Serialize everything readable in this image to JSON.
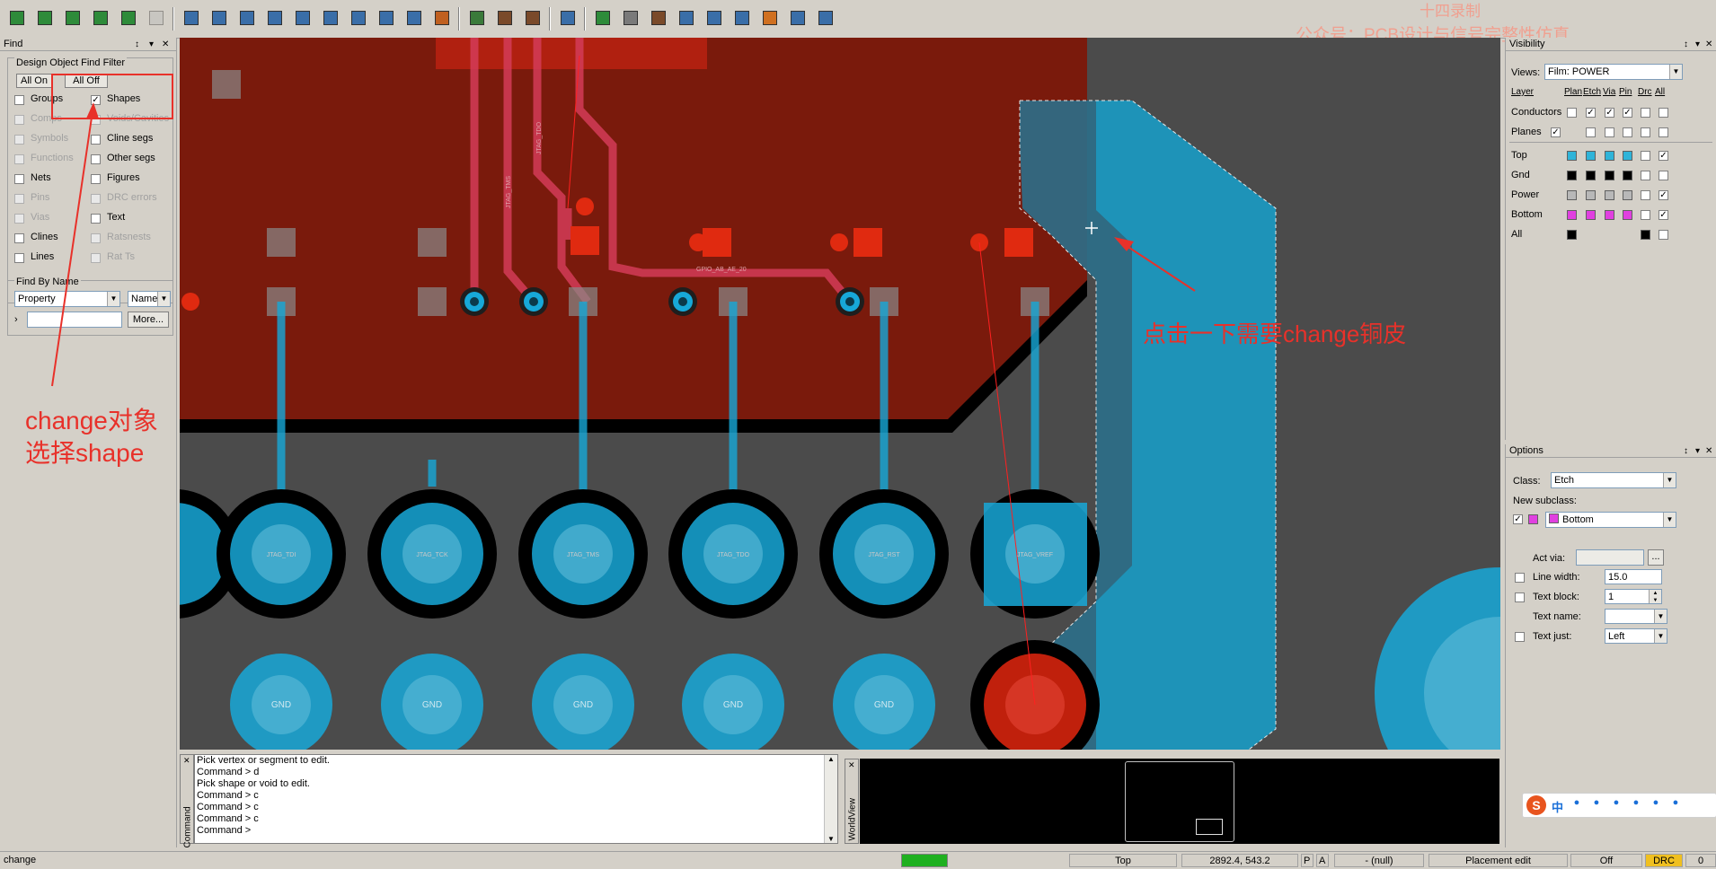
{
  "toolbar": {
    "icons": [
      "new-design-icon",
      "open-design-icon",
      "save-design-icon",
      "refresh-icon",
      "export-icon",
      "disabled-icon",
      "add-line-icon",
      "add-rect-icon",
      "add-circle-icon",
      "select-icon",
      "copy-icon",
      "rotate-icon",
      "shape-rect-icon",
      "shape-circle-icon",
      "void-icon",
      "merge-icon",
      "place-icon",
      "dimension-icon",
      "measure-icon",
      "route-icon",
      "via-icon",
      "fanout-icon",
      "slide-icon",
      "glossing-icon",
      "tuning-icon",
      "add-connect-icon",
      "spread-icon",
      "grid-icon",
      "colors-icon"
    ]
  },
  "watermark": {
    "line1": "十四录制",
    "line2": "公众号：PCB设计与信号完整性仿真"
  },
  "find_panel": {
    "title": "Find",
    "filter_title": "Design Object Find Filter",
    "all_on": "All On",
    "all_off": "All Off",
    "left_items": [
      {
        "label": "Groups",
        "enabled": true,
        "checked": false
      },
      {
        "label": "Comps",
        "enabled": false,
        "checked": false
      },
      {
        "label": "Symbols",
        "enabled": false,
        "checked": false
      },
      {
        "label": "Functions",
        "enabled": false,
        "checked": false
      },
      {
        "label": "Nets",
        "enabled": true,
        "checked": false
      },
      {
        "label": "Pins",
        "enabled": false,
        "checked": false
      },
      {
        "label": "Vias",
        "enabled": false,
        "checked": false
      },
      {
        "label": "Clines",
        "enabled": true,
        "checked": false
      },
      {
        "label": "Lines",
        "enabled": true,
        "checked": false
      }
    ],
    "right_items": [
      {
        "label": "Shapes",
        "enabled": true,
        "checked": true
      },
      {
        "label": "Voids/Cavities",
        "enabled": false,
        "checked": false
      },
      {
        "label": "Cline segs",
        "enabled": true,
        "checked": false
      },
      {
        "label": "Other segs",
        "enabled": true,
        "checked": false
      },
      {
        "label": "Figures",
        "enabled": true,
        "checked": false
      },
      {
        "label": "DRC errors",
        "enabled": false,
        "checked": false
      },
      {
        "label": "Text",
        "enabled": true,
        "checked": false
      },
      {
        "label": "Ratsnests",
        "enabled": false,
        "checked": false
      },
      {
        "label": "Rat Ts",
        "enabled": false,
        "checked": false
      }
    ],
    "find_by_name_title": "Find By Name",
    "property_select": "Property",
    "name_select": "Name",
    "name_input": "",
    "more_button": "More..."
  },
  "visibility_panel": {
    "title": "Visibility",
    "views_label": "Views:",
    "views_value": "Film: POWER",
    "headers": [
      "Layer",
      "Plan",
      "Etch",
      "Via",
      "Pin",
      "Drc",
      "All"
    ],
    "conductors_label": "Conductors",
    "planes_label": "Planes",
    "layers": [
      {
        "name": "Top",
        "color": "#2fb4d9"
      },
      {
        "name": "Gnd",
        "color": "#000000"
      },
      {
        "name": "Power",
        "color": "#b8b8b8"
      },
      {
        "name": "Bottom",
        "color": "#e040e0"
      },
      {
        "name": "All",
        "color": "#000000"
      }
    ]
  },
  "options_panel": {
    "title": "Options",
    "class_label": "Class:",
    "class_value": "Etch",
    "new_subclass_label": "New subclass:",
    "subclass_value": "Bottom",
    "subclass_color": "#e040e0",
    "act_via_label": "Act via:",
    "act_via_button": "...",
    "line_width_label": "Line width:",
    "line_width_value": "15.0",
    "text_block_label": "Text block:",
    "text_block_value": "1",
    "text_name_label": "Text name:",
    "text_name_value": "",
    "text_just_label": "Text just:",
    "text_just_value": "Left"
  },
  "canvas": {
    "pad_labels_top": [
      "JTAG_TDI",
      "JTAG_TCK",
      "JTAG_TMS",
      "JTAG_TDO",
      "JTAG_RST",
      "JTAG_VREF"
    ],
    "pad_labels_bottom": [
      "GND",
      "GND",
      "GND",
      "GND",
      "GND"
    ],
    "net_labels": [
      "JTAG_TMS",
      "JTAG_TDO",
      "GPIO_AB_AE_20"
    ],
    "colors": {
      "board": "#4b4b4b",
      "power_plane": "#7a1a0c",
      "bottom_shape": "#2596be",
      "trace": "#d43c58",
      "pad": "#17a8d8"
    }
  },
  "annotations": {
    "left_note_line1": "change对象",
    "left_note_line2": "选择shape",
    "right_note": "点击一下需要change铜皮"
  },
  "command": {
    "title": "Command",
    "lines": [
      "Pick vertex or segment to edit.",
      "Command > d",
      "Pick shape or void to edit.",
      "Command > c",
      "Command > c",
      "Command > c",
      "Command >"
    ]
  },
  "worldview": {
    "title": "WorldView"
  },
  "ime": {
    "icons": [
      "sogou-logo-icon",
      "chinese-mode-icon",
      "punctuation-icon",
      "mic-icon",
      "keyboard-icon",
      "skin-icon",
      "toolbox-icon",
      "grid-icon"
    ],
    "mode_label": "中"
  },
  "status_bar": {
    "command": "change",
    "layer": "Top",
    "coordinates": "2892.4, 543.2",
    "p_flag": "P",
    "a_flag": "A",
    "null_text": "- (null)",
    "mode": "Placement edit",
    "off": "Off",
    "drc": "DRC",
    "count": "0"
  }
}
